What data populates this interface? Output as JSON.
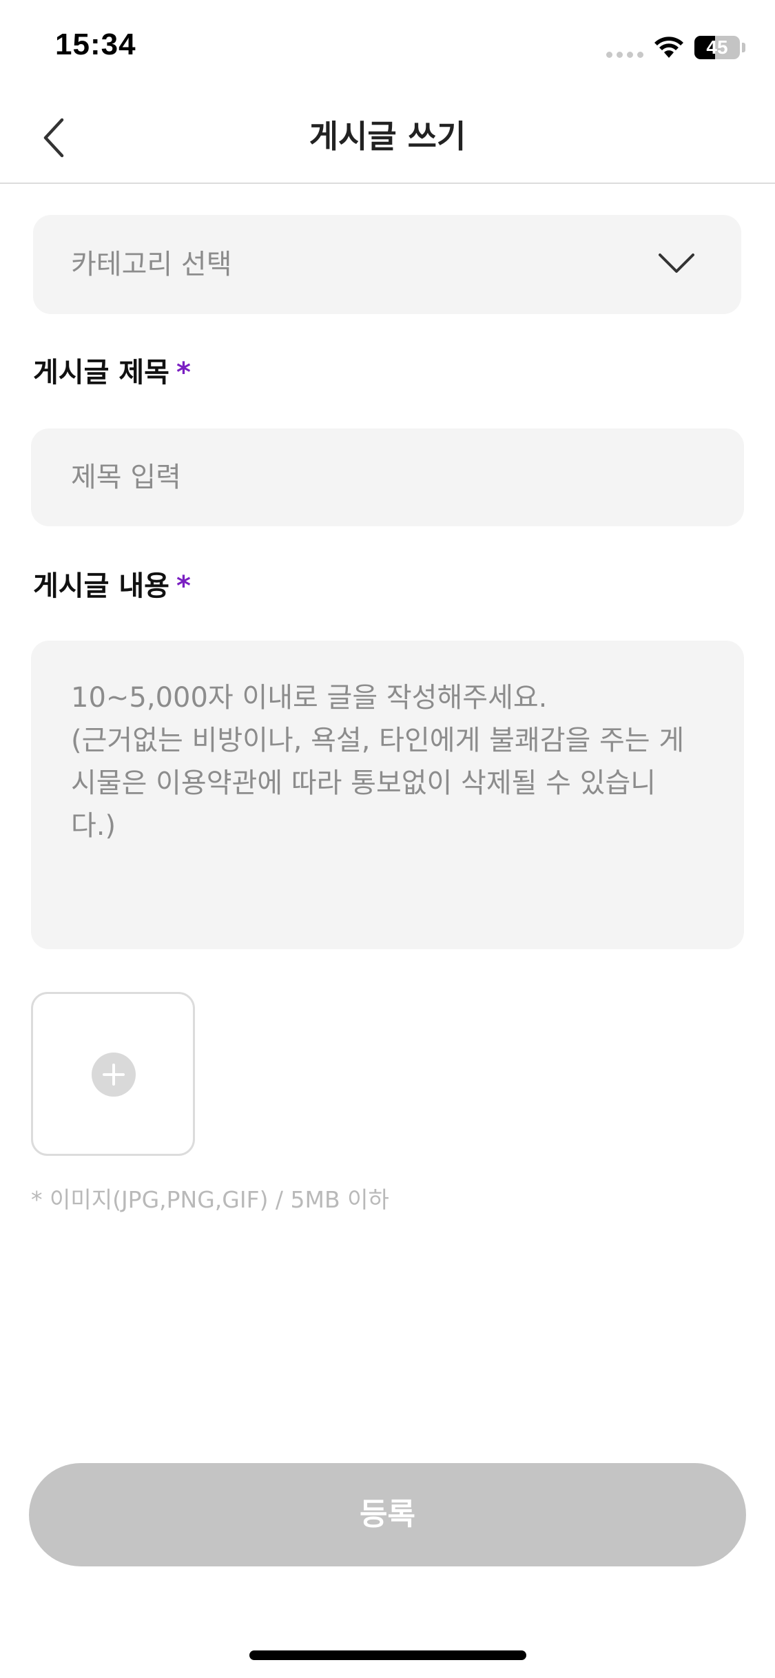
{
  "status_bar": {
    "time": "15:34",
    "battery_level": "45",
    "battery_fraction": 0.45
  },
  "header": {
    "title": "게시글 쓰기",
    "back_icon": "chevron-left-icon"
  },
  "category": {
    "placeholder": "카테고리 선택",
    "icon": "chevron-down-icon"
  },
  "title_field": {
    "label": "게시글 제목",
    "required_mark": "*",
    "placeholder": "제목 입력"
  },
  "content_field": {
    "label": "게시글 내용",
    "required_mark": "*",
    "placeholder_lines": [
      "10~5,000자 이내로 글을 작성해주세요.",
      "(근거없는 비방이나, 욕설, 타인에게 불쾌감을 주는 게",
      "시물은 이용약관에 따라 통보없이 삭제될 수 있습니",
      "다.)"
    ]
  },
  "image_upload": {
    "icon": "plus-icon",
    "hint": "* 이미지(JPG,PNG,GIF) / 5MB 이하"
  },
  "submit": {
    "label": "등록"
  },
  "colors": {
    "accent_required": "#7a1fc2",
    "field_background": "#f4f4f4",
    "button_disabled": "#c4c4c4"
  }
}
